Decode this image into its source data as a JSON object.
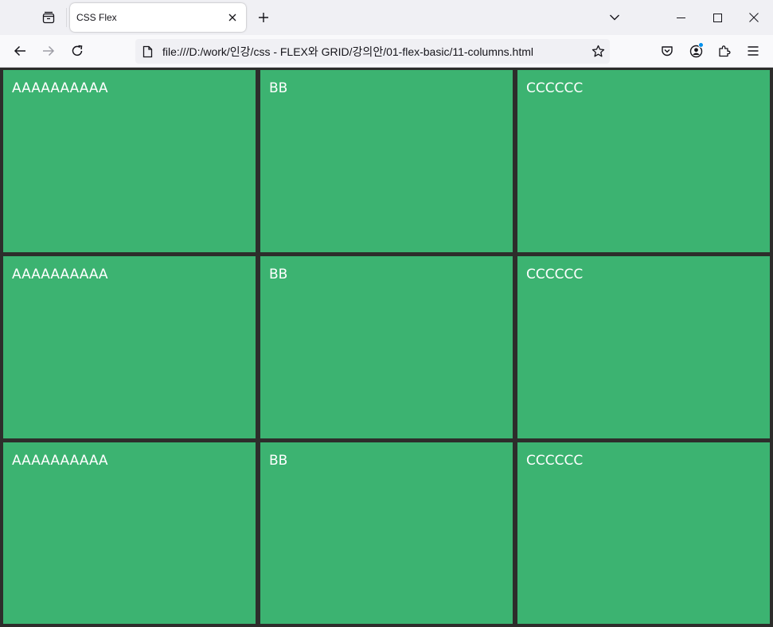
{
  "tabs": [
    {
      "title": "CSS Flex",
      "active": true
    }
  ],
  "address_bar": {
    "url": "file:///D:/work/인강/css - FLEX와 GRID/강의안/01-flex-basic/11-columns.html"
  },
  "icons": {
    "tab_list": "tab-list-icon",
    "tab_close": "close-icon",
    "new_tab": "plus-icon",
    "tab_overflow": "chevron-down-icon",
    "minimize": "minimize-icon",
    "maximize": "maximize-icon",
    "close_window": "close-icon",
    "back": "arrow-left-icon",
    "forward": "arrow-right-icon",
    "reload": "reload-icon",
    "page": "document-icon",
    "bookmark": "star-icon",
    "pocket": "pocket-icon",
    "account": "account-icon",
    "extensions": "puzzle-icon",
    "menu": "hamburger-icon"
  },
  "colors": {
    "page_background": "#2d2d2b",
    "cell_background": "#3cb371",
    "cell_text": "#ffffff",
    "account_badge": "#0090ed"
  },
  "grid": {
    "rows": [
      {
        "cells": [
          "AAAAAAAAAA",
          "BB",
          "CCCCCC"
        ]
      },
      {
        "cells": [
          "AAAAAAAAAA",
          "BB",
          "CCCCCC"
        ]
      },
      {
        "cells": [
          "AAAAAAAAAA",
          "BB",
          "CCCCCC"
        ]
      }
    ]
  }
}
